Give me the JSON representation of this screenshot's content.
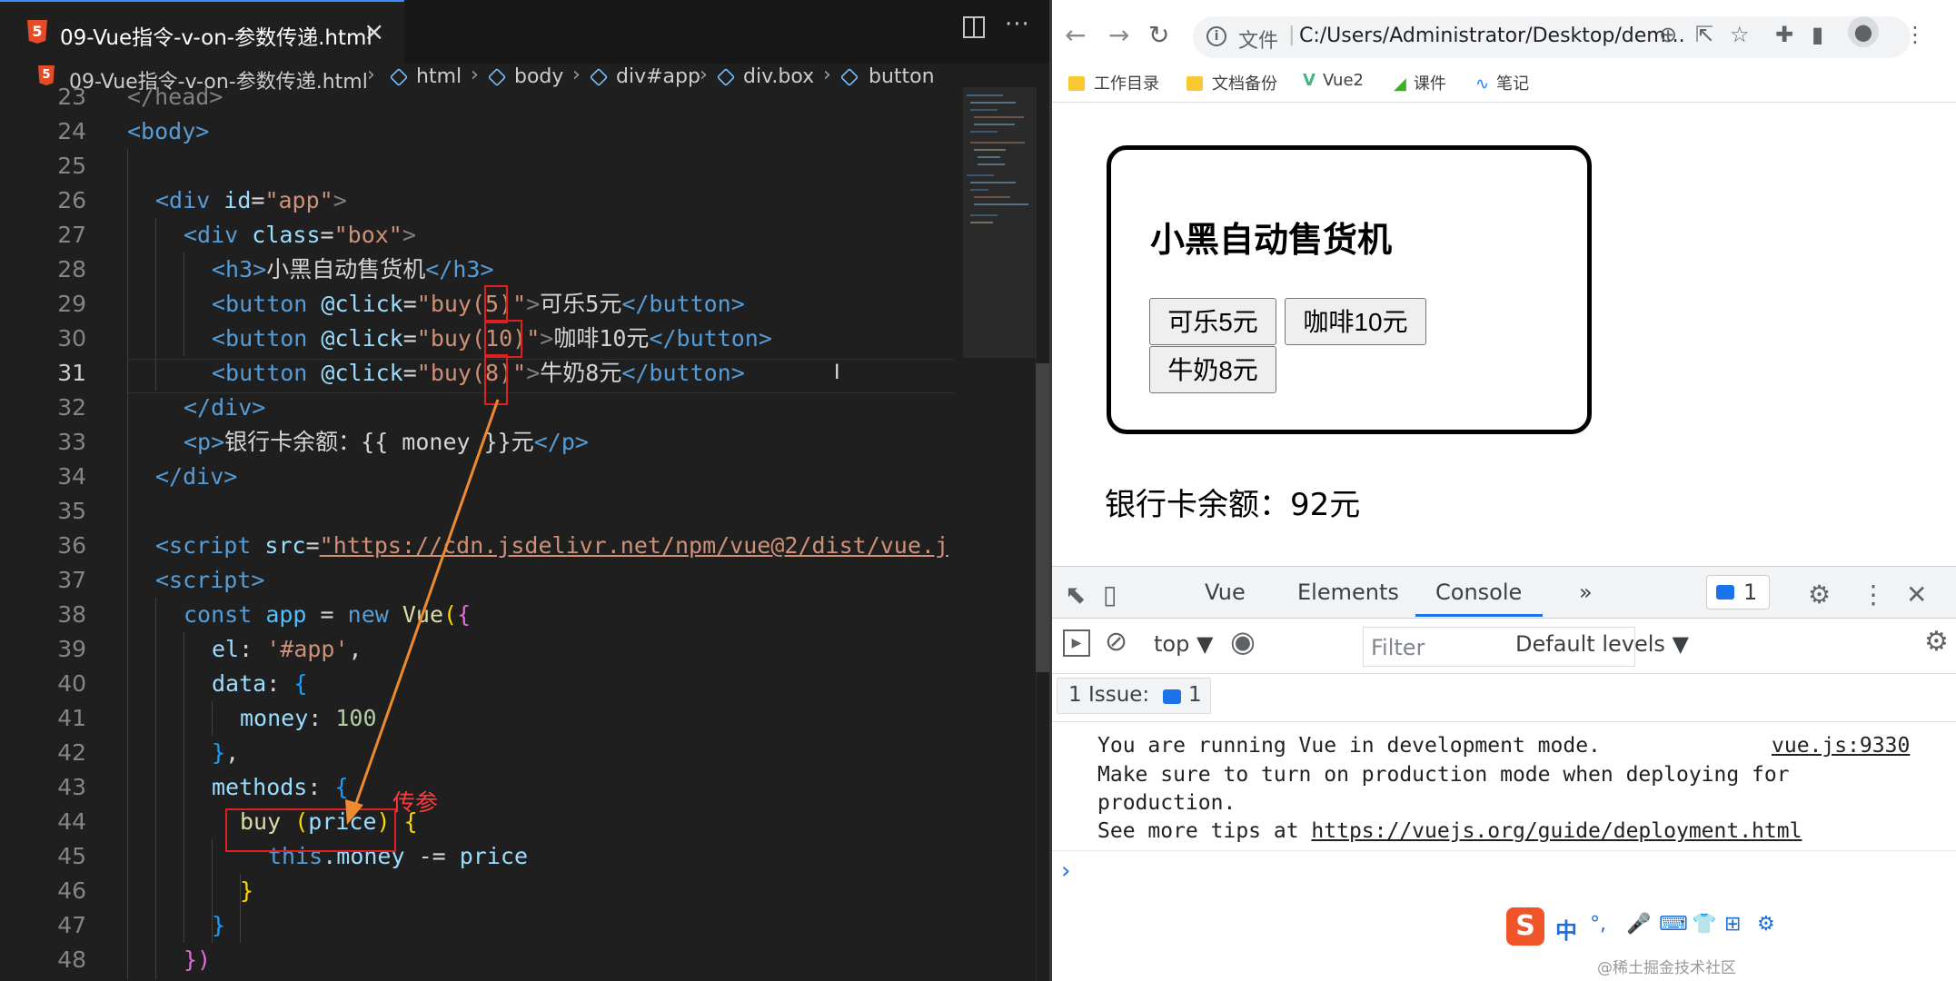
{
  "editor": {
    "tab_title": "09-Vue指令-v-on-参数传递.html",
    "tab_badge": "5",
    "tab_close": "×",
    "more": "···",
    "breadcrumb": [
      "09-Vue指令-v-on-参数传递.html",
      "html",
      "body",
      "div#app",
      "div.box",
      "button"
    ],
    "line_numbers": [
      "23",
      "24",
      "25",
      "26",
      "27",
      "28",
      "29",
      "30",
      "31",
      "32",
      "33",
      "34",
      "35",
      "36",
      "37",
      "38",
      "39",
      "40",
      "41",
      "42",
      "43",
      "44",
      "45",
      "46",
      "47",
      "48"
    ],
    "lines": {
      "l23": "</head>",
      "l24": "<body>",
      "l26a": "<div",
      "l26b": " id",
      "l26c": "=",
      "l26d": "\"app\"",
      "l26e": ">",
      "l27a": "<div",
      "l27b": " class",
      "l27c": "=",
      "l27d": "\"box\"",
      "l27e": ">",
      "l28a": "<h3>",
      "l28b": "小黑自动售货机",
      "l28c": "</h3>",
      "l29a": "<button",
      "l29b": " @click",
      "l29c": "=",
      "l29d": "\"buy(5)\"",
      "l29e": ">",
      "l29f": "可乐5元",
      "l29g": "</button>",
      "l30a": "<button",
      "l30b": " @click",
      "l30c": "=",
      "l30d": "\"buy(10)\"",
      "l30e": ">",
      "l30f": "咖啡10元",
      "l30g": "</button>",
      "l31a": "<button",
      "l31b": " @click",
      "l31c": "=",
      "l31d": "\"buy(8)\"",
      "l31e": ">",
      "l31f": "牛奶8元",
      "l31g": "</button>",
      "l32": "</div>",
      "l33a": "<p>",
      "l33b": "银行卡余额：{{ money }}元",
      "l33c": "</p>",
      "l34": "</div>",
      "l36a": "<script",
      "l36b": " src",
      "l36c": "=",
      "l36d": "\"https://cdn.jsdelivr.net/npm/vue@2/dist/vue.j",
      "l37": "<script>",
      "l38a": "const",
      "l38b": " app",
      "l38c": " = ",
      "l38d": "new",
      "l38e": " Vue",
      "l38f": "(",
      "l38g": "{",
      "l39a": "el",
      "l39b": ": ",
      "l39c": "'#app'",
      "l39d": ",",
      "l40a": "data",
      "l40b": ": ",
      "l40c": "{",
      "l41a": "money",
      "l41b": ": ",
      "l41c": "100",
      "l42a": "}",
      "l42b": ",",
      "l43a": "methods",
      "l43b": ": ",
      "l43c": "{",
      "l44a": "buy",
      "l44b": " (",
      "l44c": "price",
      "l44d": ")",
      "l44e": " {",
      "l45a": "this",
      "l45b": ".money",
      "l45c": " -= ",
      "l45d": "price",
      "l46": "}",
      "l47": "}",
      "l48": "})"
    },
    "annotation": "传参"
  },
  "browser": {
    "url_label": "文件",
    "url": "C:/Users/Administrator/Desktop/dem...",
    "bookmarks": [
      "工作目录",
      "文档备份",
      "Vue2",
      "课件",
      "笔记"
    ],
    "page": {
      "title": "小黑自动售货机",
      "buttons": [
        "可乐5元",
        "咖啡10元",
        "牛奶8元"
      ],
      "money_text": "银行卡余额：92元"
    },
    "devtools": {
      "tabs": [
        "Vue",
        "Elements",
        "Console"
      ],
      "tab_more": "»",
      "issue_count": "1",
      "context": "top ▼",
      "filter_placeholder": "Filter",
      "levels": "Default levels ▼",
      "issues_label": "1 Issue:",
      "issues_count": "1",
      "console_lines": [
        "You are running Vue in development mode.",
        "Make sure to turn on production mode when deploying for",
        "production.",
        "See more tips at "
      ],
      "console_url": "https://vuejs.org/guide/deployment.html",
      "source_link": "vue.js:9330",
      "prompt": "›"
    },
    "ime": [
      "中",
      "°,",
      "🎤",
      "⌨",
      "👕",
      "⊞",
      "⚙"
    ],
    "watermark": "@稀土掘金技术社区"
  }
}
